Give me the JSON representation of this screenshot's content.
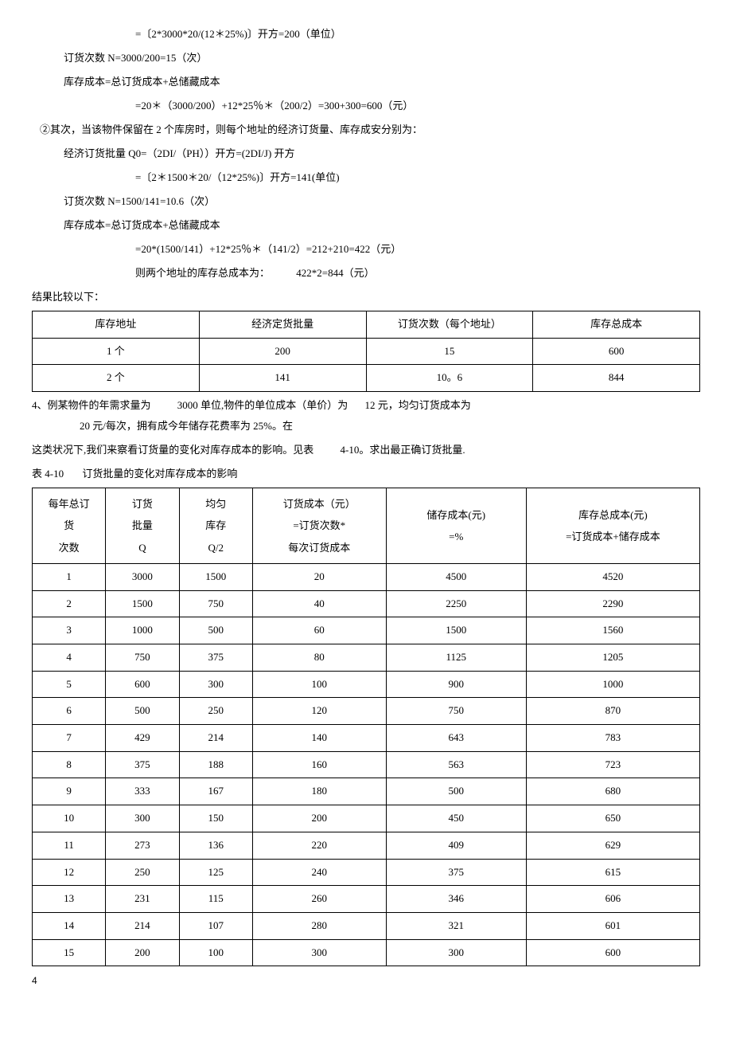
{
  "lines": {
    "l1": "=〔2*3000*20/(12＊25%)〕开方=200（单位）",
    "l2": "订货次数 N=3000/200=15（次）",
    "l3": "库存成本=总订货成本+总储藏成本",
    "l4": "=20＊（3000/200）+12*25％＊（200/2）=300+300=600（元）",
    "l5": "②其次，当该物件保留在 2 个库房时，则每个地址的经济订货量、库存成安分别为：",
    "l6": "经济订货批量 Q0=（2DI/（PH））开方=(2DI/J) 开方",
    "l7": "=〔2＊1500＊20/（12*25%)〕开方=141(单位)",
    "l8": "订货次数 N=1500/141=10.6（次）",
    "l9": "库存成本=总订货成本+总储藏成本",
    "l10": "=20*(1500/141）+12*25％＊（141/2）=212+210=422（元）",
    "l11a": "则两个地址的库存总成本为：",
    "l11b": "422*2=844（元）",
    "l12": "结果比较以下：",
    "l13_a": "4、例某物件的年需求量为",
    "l13_b": "3000 单位,物件的单位成本（单价）为",
    "l13_c": "12 元，均匀订货成本为",
    "l13_d": "20 元/每次，拥有成今年储存花费率为 25%。在",
    "l14_a": "这类状况下,我们来察看订货量的变化对库存成本的影响。见表",
    "l14_b": "4-10。求出最正确订货批量.",
    "l15_a": "表 4-10",
    "l15_b": "订货批量的变化对库存成本的影响",
    "page_num": "4"
  },
  "table1": {
    "headers": [
      "库存地址",
      "经济定货批量",
      "订货次数（每个地址）",
      "库存总成本"
    ],
    "rows": [
      [
        "1 个",
        "200",
        "15",
        "600"
      ],
      [
        "2 个",
        "141",
        "10。6",
        "844"
      ]
    ]
  },
  "table2": {
    "headers": [
      {
        "l1": "每年总订",
        "l2": "货",
        "l3": "次数"
      },
      {
        "l1": "订货",
        "l2": "批量",
        "l3": "Q"
      },
      {
        "l1": "均匀",
        "l2": "库存",
        "l3": "Q/2"
      },
      {
        "l1": "订货成本（元）",
        "l2": "=订货次数*",
        "l3": "每次订货成本"
      },
      {
        "l1": "储存成本(元)",
        "l2": "=%",
        "l3": ""
      },
      {
        "l1": "库存总成本(元)",
        "l2": "=订货成本+储存成本",
        "l3": ""
      }
    ],
    "rows": [
      [
        "1",
        "3000",
        "1500",
        "20",
        "4500",
        "4520"
      ],
      [
        "2",
        "1500",
        "750",
        "40",
        "2250",
        "2290"
      ],
      [
        "3",
        "1000",
        "500",
        "60",
        "1500",
        "1560"
      ],
      [
        "4",
        "750",
        "375",
        "80",
        "1125",
        "1205"
      ],
      [
        "5",
        "600",
        "300",
        "100",
        "900",
        "1000"
      ],
      [
        "6",
        "500",
        "250",
        "120",
        "750",
        "870"
      ],
      [
        "7",
        "429",
        "214",
        "140",
        "643",
        "783"
      ],
      [
        "8",
        "375",
        "188",
        "160",
        "563",
        "723"
      ],
      [
        "9",
        "333",
        "167",
        "180",
        "500",
        "680"
      ],
      [
        "10",
        "300",
        "150",
        "200",
        "450",
        "650"
      ],
      [
        "11",
        "273",
        "136",
        "220",
        "409",
        "629"
      ],
      [
        "12",
        "250",
        "125",
        "240",
        "375",
        "615"
      ],
      [
        "13",
        "231",
        "115",
        "260",
        "346",
        "606"
      ],
      [
        "14",
        "214",
        "107",
        "280",
        "321",
        "601"
      ],
      [
        "15",
        "200",
        "100",
        "300",
        "300",
        "600"
      ]
    ]
  }
}
